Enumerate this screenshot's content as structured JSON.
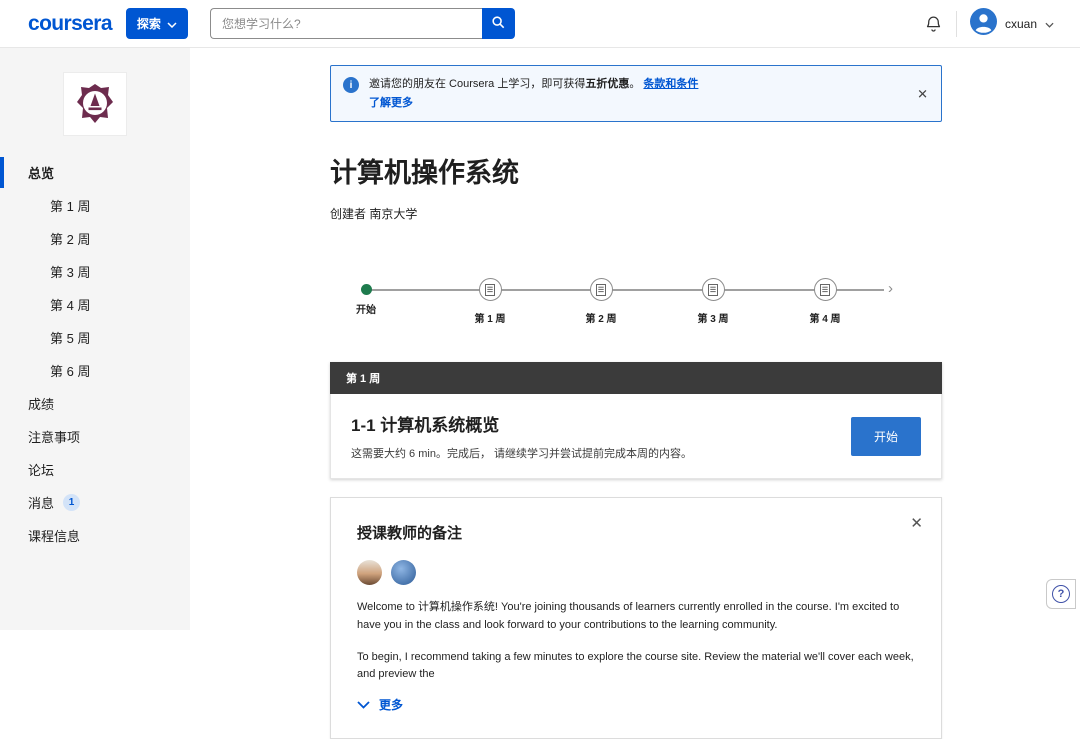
{
  "header": {
    "logo": "coursera",
    "explore_label": "探索",
    "search_placeholder": "您想学习什么?",
    "username": "cxuan"
  },
  "sidebar": {
    "items": [
      {
        "label": "总览"
      },
      {
        "label": "第 1 周"
      },
      {
        "label": "第 2 周"
      },
      {
        "label": "第 3 周"
      },
      {
        "label": "第 4 周"
      },
      {
        "label": "第 5 周"
      },
      {
        "label": "第 6 周"
      },
      {
        "label": "成绩"
      },
      {
        "label": "注意事项"
      },
      {
        "label": "论坛"
      },
      {
        "label": "消息",
        "badge": "1"
      },
      {
        "label": "课程信息"
      }
    ]
  },
  "banner": {
    "info_glyph": "i",
    "text1": "邀请您的朋友在 Coursera 上学习，即可获得",
    "highlight": "五折优惠",
    "text2": "。",
    "terms_link": "条款和条件",
    "more_link": "了解更多",
    "close_glyph": "✕"
  },
  "course": {
    "title": "计算机操作系统",
    "creator_label": "创建者",
    "creator_name": "南京大学"
  },
  "timeline": {
    "start_label": "开始",
    "milestones": [
      "第 1 周",
      "第 2 周",
      "第 3 周",
      "第 4 周"
    ],
    "arrow_glyph": "›"
  },
  "week": {
    "bar_label": "第 1 周",
    "lesson_title": "1-1 计算机系统概览",
    "lesson_desc": "这需要大约 6 min。完成后， 请继续学习并尝试提前完成本周的内容。",
    "start_button": "开始"
  },
  "notes": {
    "title": "授课教师的备注",
    "close_glyph": "✕",
    "paragraph1": "Welcome to 计算机操作系统! You're joining thousands of learners currently enrolled in the course. I'm excited to have you in the class and look forward to your contributions to the learning community.",
    "paragraph2": "To begin, I recommend taking a few minutes to explore the course site. Review the material we'll cover each week, and preview the",
    "more_label": "更多"
  },
  "help": {
    "glyph": "?"
  },
  "colors": {
    "brand_blue": "#0056d2",
    "button_blue": "#2a73cc",
    "banner_bg": "#f3f8fe",
    "week_bar": "#3b3b3b",
    "start_green": "#1e7b4d",
    "sidebar_bg": "#f5f5f5"
  }
}
